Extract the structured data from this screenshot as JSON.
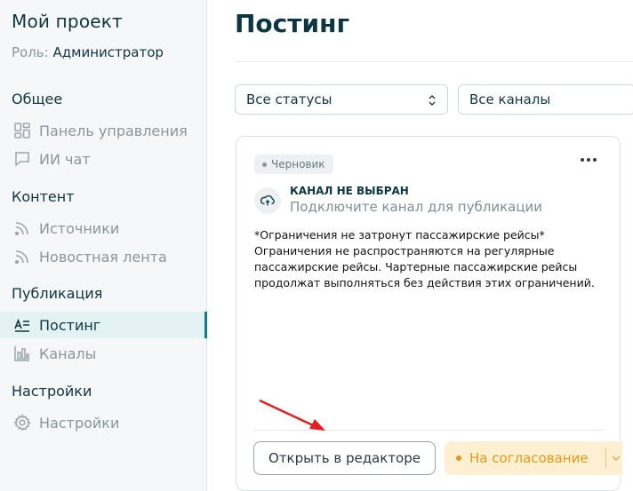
{
  "sidebar": {
    "project_title": "Мой проект",
    "role_label": "Роль:",
    "role_value": "Администратор",
    "sections": {
      "general": "Общее",
      "content": "Контент",
      "publication": "Публикация",
      "settings": "Настройки"
    },
    "items": [
      {
        "label": "Панель управления",
        "icon": "dashboard-icon"
      },
      {
        "label": "ИИ чат",
        "icon": "chat-icon"
      },
      {
        "label": "Источники",
        "icon": "rss-icon"
      },
      {
        "label": "Новостная лента",
        "icon": "rss-icon"
      },
      {
        "label": "Постинг",
        "icon": "posting-icon",
        "active": true
      },
      {
        "label": "Каналы",
        "icon": "bar-chart-icon"
      },
      {
        "label": "Настройки",
        "icon": "gear-icon"
      }
    ]
  },
  "main": {
    "title": "Постинг",
    "filters": {
      "status": "Все статусы",
      "channels": "Все каналы"
    },
    "card": {
      "badge": "Черновик",
      "channel_title": "КАНАЛ НЕ ВЫБРАН",
      "channel_subtitle": "Подключите канал для публикации",
      "body_lines": [
        "*Ограничения не затронут пассажирские рейсы*",
        "Ограничения не распространяются на регулярные",
        "пассажирские рейсы. Чартерные пассажирские рейсы",
        "продолжат выполняться без действия этих ограничений."
      ],
      "open_editor_label": "Открыть в редакторе",
      "approve_label": "На согласование"
    }
  },
  "colors": {
    "accent": "#127c86",
    "active_bg": "#e3f3f3",
    "approve_bg": "#fdf0d2",
    "approve_text": "#e69a13",
    "annotation_arrow": "#e02020"
  }
}
